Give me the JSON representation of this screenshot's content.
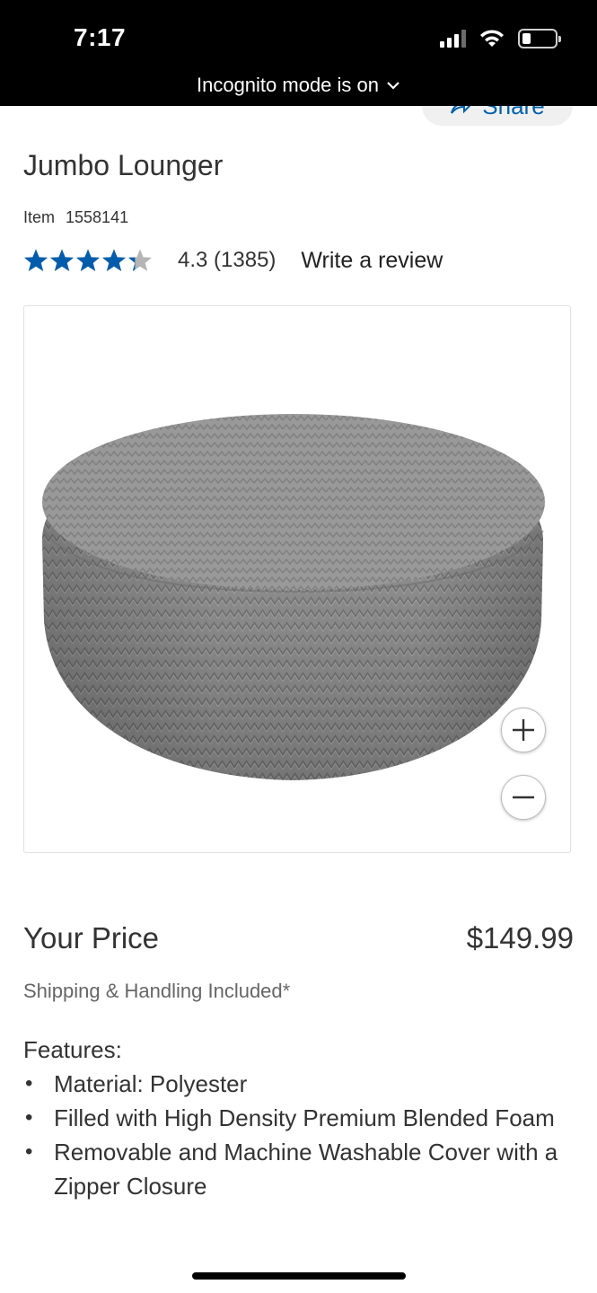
{
  "status_bar": {
    "time": "7:17",
    "incognito_text": "Incognito mode is on"
  },
  "share": {
    "label": "Share"
  },
  "product": {
    "title": "Jumbo Lounger",
    "item_label": "Item",
    "item_number": "1558141",
    "rating_text": "4.3 (1385)",
    "rating_value": 4.3,
    "review_link": "Write a review",
    "image_icon": "product-photo-pouf"
  },
  "price": {
    "label": "Your Price",
    "value": "$149.99",
    "shipping": "Shipping & Handling Included*"
  },
  "features": {
    "heading": "Features:",
    "items": [
      "Material: Polyester",
      "Filled with High Density Premium Blended Foam",
      "Removable and Machine Washable Cover with a Zipper Closure"
    ]
  },
  "colors": {
    "star_filled": "#005dab",
    "star_empty": "#b5b5b5",
    "link_blue": "#0060a9",
    "text": "#333333",
    "status_bar_bg": "#000000"
  }
}
